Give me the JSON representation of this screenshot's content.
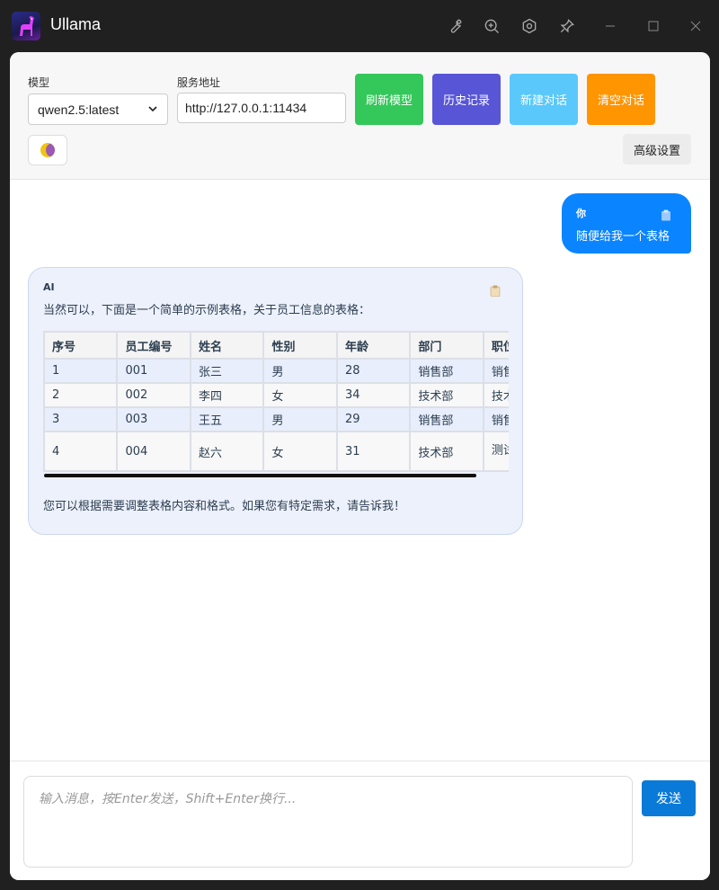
{
  "window": {
    "title": "Ullama",
    "title_icons": [
      "wrench-icon",
      "zoom-in-icon",
      "hexagon-settings-icon",
      "pin-icon",
      "minimize-icon",
      "maximize-icon",
      "close-icon"
    ]
  },
  "toolbar": {
    "model_label": "模型",
    "model_value": "qwen2.5:latest",
    "url_label": "服务地址",
    "url_value": "http://127.0.0.1:11434",
    "buttons": [
      {
        "label": "刷新模型",
        "color": "#34c759"
      },
      {
        "label": "历史记录",
        "color": "#5856d6"
      },
      {
        "label": "新建对话",
        "color": "#5ac8fa"
      },
      {
        "label": "清空对话",
        "color": "#ff9500"
      }
    ],
    "theme_icon": "moon-icon",
    "advanced_label": "高级设置"
  },
  "chat": {
    "user_message": {
      "sender": "你",
      "text": "随便给我一个表格"
    },
    "ai_message": {
      "sender": "AI",
      "intro": "当然可以，下面是一个简单的示例表格，关于员工信息的表格：",
      "table": {
        "headers": [
          "序号",
          "员工编号",
          "姓名",
          "性别",
          "年龄",
          "部门",
          "职位"
        ],
        "rows": [
          [
            "1",
            "001",
            "张三",
            "男",
            "28",
            "销售部",
            "销售经理"
          ],
          [
            "2",
            "002",
            "李四",
            "女",
            "34",
            "技术部",
            "技术总监"
          ],
          [
            "3",
            "003",
            "王五",
            "男",
            "29",
            "销售部",
            "销售代表"
          ],
          [
            "4",
            "004",
            "赵六",
            "女",
            "31",
            "技术部",
            "测试工程师"
          ]
        ]
      },
      "outro": "您可以根据需要调整表格内容和格式。如果您有特定需求，请告诉我！"
    }
  },
  "input": {
    "placeholder": "输入消息，按Enter发送，Shift+Enter换行...",
    "send_label": "发送"
  }
}
